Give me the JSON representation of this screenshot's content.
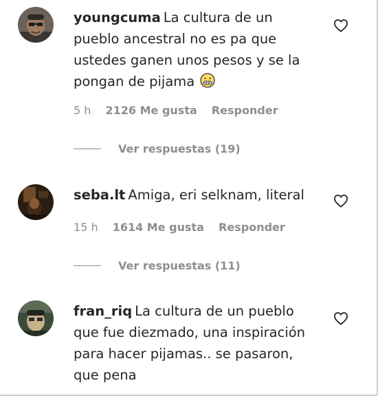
{
  "comments": [
    {
      "username": "youngcuma",
      "text": "La cultura de un pueblo ancestral no es pa que ustedes ganen unos pesos y se la pongan de pijama",
      "emoji": "grimacing-face-emoji",
      "time": "5 h",
      "likes": "2126 Me gusta",
      "reply_label": "Responder",
      "view_replies": "Ver respuestas (19)"
    },
    {
      "username": "seba.lt",
      "text": "Amiga, eri selknam, literal",
      "time": "15 h",
      "likes": "1614 Me gusta",
      "reply_label": "Responder",
      "view_replies": "Ver respuestas (11)"
    },
    {
      "username": "fran_riq",
      "text": "La cultura de un pueblo que fue diezmado, una inspiración para hacer pijamas.. se pasaron, que pena"
    }
  ],
  "icons": {
    "like": "heart-outline-icon"
  },
  "colors": {
    "text": "#262626",
    "secondary": "#8e8e8e",
    "background": "#ffffff"
  }
}
